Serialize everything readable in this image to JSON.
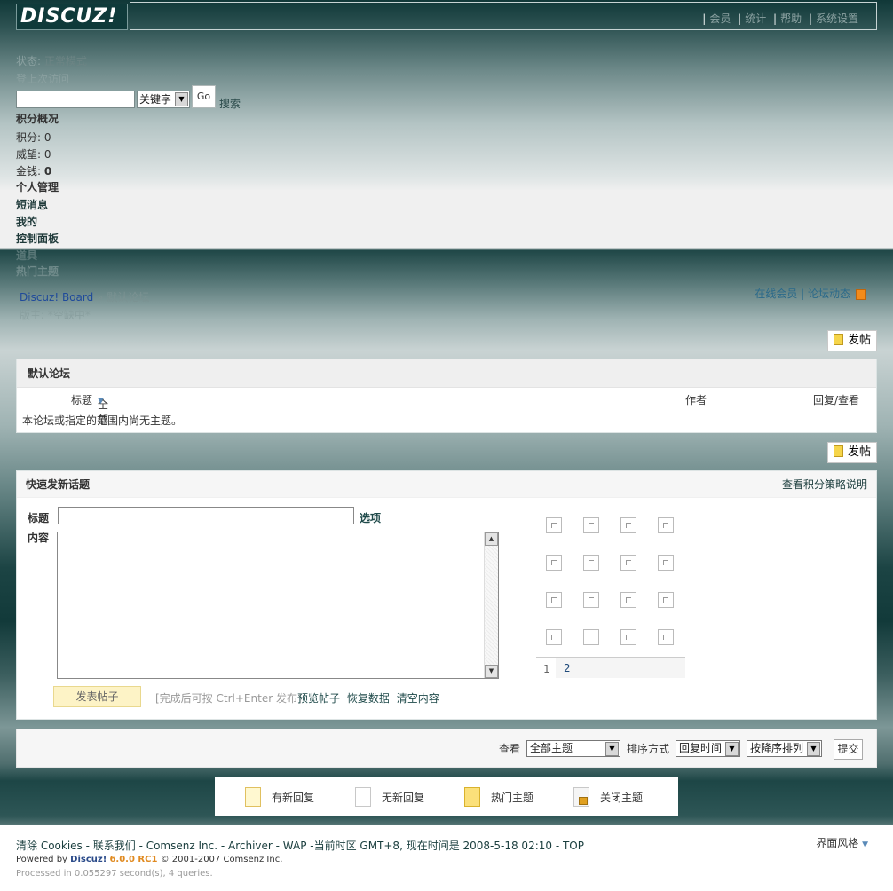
{
  "header": {
    "logo_text": "DISCUZ!",
    "nav": [
      "会员",
      "统计",
      "帮助",
      "系统设置"
    ]
  },
  "sidebar": {
    "mode_label": "状态:",
    "mode_value": "正常模式",
    "extra_line": "登上次访问",
    "search_placeholder": "",
    "search_type": "关键字",
    "go_label": "Go",
    "search_link": "搜索",
    "credits_title": "积分概况",
    "credits": [
      {
        "label": "积分",
        "value": "0"
      },
      {
        "label": "威望",
        "value": "0"
      },
      {
        "label": "金钱",
        "value": "0"
      }
    ],
    "menu": [
      "个人管理",
      "短消息",
      "我的",
      "控制面板",
      "道具",
      "热门主题"
    ]
  },
  "breadcrumb": {
    "home": "Discuz! Board",
    "current": "默认论坛",
    "sub": "版主: *空缺中*",
    "right_links": "在线会员 | 论坛动态"
  },
  "post_button": "发帖",
  "forum": {
    "title": "默认论坛",
    "col_title": "标题",
    "col_filter": "全部",
    "col_author": "作者",
    "col_replies": "回复/查看",
    "empty_message": "本论坛或指定的范围内尚无主题。"
  },
  "quick_post": {
    "title": "快速发新话题",
    "credit_link": "查看积分策略说明",
    "subject_label": "标题",
    "options_link": "选项",
    "content_label": "内容",
    "submit_label": "发表帖子",
    "hint_prefix": "[完成后可按",
    "hint_keys": "Ctrl+Enter",
    "hint_suffix": "发布]",
    "actions": [
      "预览帖子",
      "恢复数据",
      "清空内容"
    ],
    "pages": [
      "1",
      "2"
    ]
  },
  "filter": {
    "view_label": "查看",
    "view_value": "全部主题",
    "sort_label": "排序方式",
    "sort_value": "回复时间",
    "order_value": "按降序排列",
    "submit": "提交"
  },
  "legend": [
    "有新回复",
    "无新回复",
    "热门主题",
    "关闭主题"
  ],
  "footer": {
    "line1": "清除  Cookies - 联系我们  - Comsenz Inc. - Archiver - WAP -当前时区  GMT+8, 现在时间是  2008-5-18 02:10 - TOP",
    "powered_prefix": "Powered by",
    "powered_brand": "Discuz!",
    "powered_version": "6.0.0 RC1",
    "powered_suffix": "© 2001-2007 Comsenz Inc.",
    "processed": "Processed in 0.055297 second(s), 4 queries.",
    "style_label": "界面风格"
  }
}
